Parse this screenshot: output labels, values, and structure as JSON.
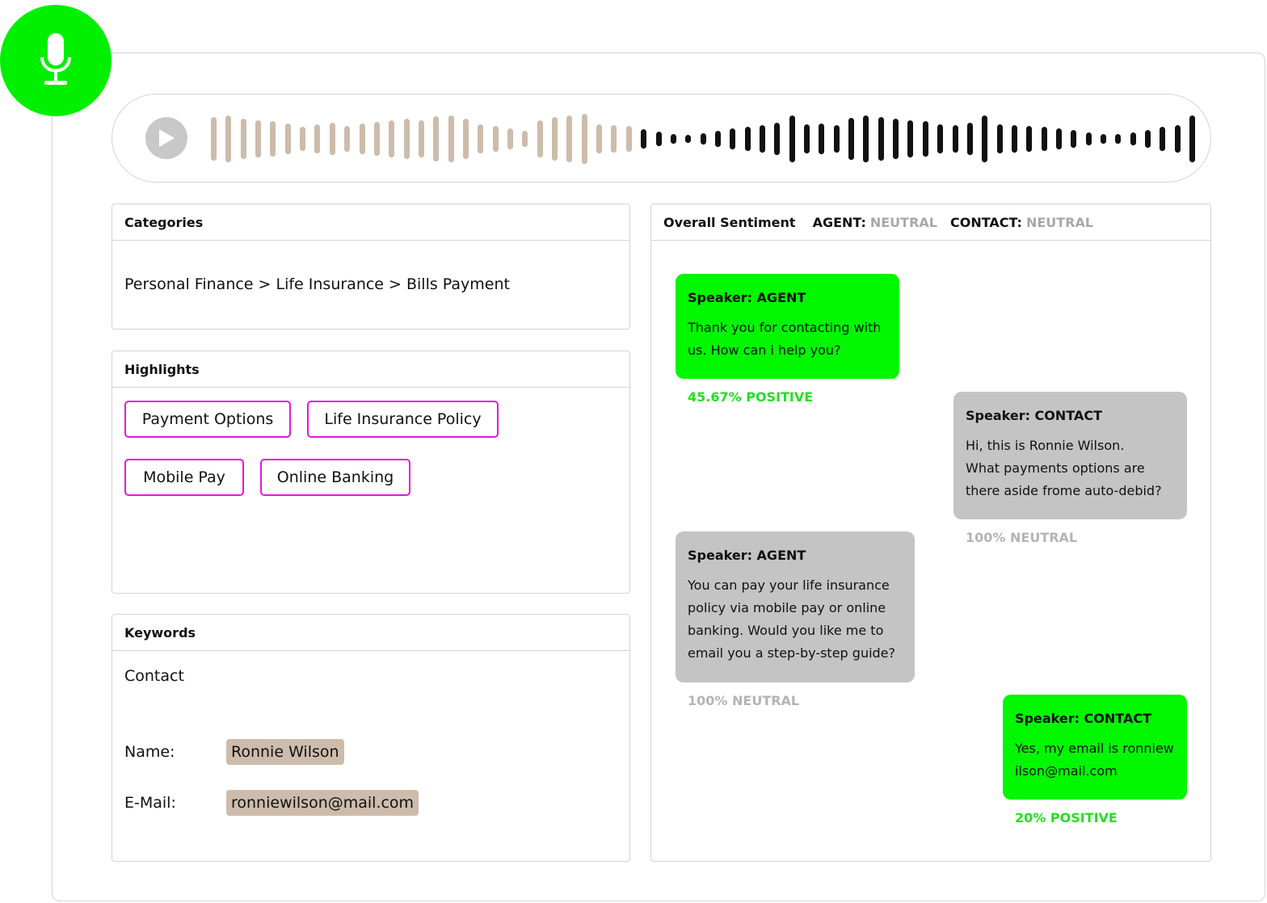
{
  "app": {
    "mic_icon": "microphone-icon",
    "accent": "#00f000"
  },
  "player": {
    "play_icon": "play-icon",
    "played_color": "#cdbcab",
    "remaining_color": "#111111",
    "progress": 0.42
  },
  "categories": {
    "title": "Categories",
    "path": "Personal Finance > Life Insurance > Bills Payment"
  },
  "highlights": {
    "title": "Highlights",
    "chips": [
      "Payment Options",
      "Life Insurance Policy",
      "Mobile Pay",
      "Online Banking"
    ],
    "chip_color": "#e516e0"
  },
  "keywords": {
    "title": "Keywords",
    "section": "Contact",
    "name_label": "Name:",
    "name_value": "Ronnie Wilson",
    "email_label": "E-Mail:",
    "email_value": "ronniewilson@mail.com"
  },
  "sentiment": {
    "title": "Overall Sentiment",
    "agent_label": "AGENT:",
    "agent_value": "NEUTRAL",
    "contact_label": "CONTACT:",
    "contact_value": "NEUTRAL",
    "messages": [
      {
        "speaker": "Speaker: AGENT",
        "text": "Thank you for contacting with us. How can i help you?",
        "score": "45.67% POSITIVE"
      },
      {
        "speaker": "Speaker: CONTACT",
        "text": "Hi, this is Ronnie Wilson.\nWhat payments options are\n there  aside frome auto-debid?",
        "score": "100% NEUTRAL"
      },
      {
        "speaker": "Speaker: AGENT",
        "text": "You can pay your life insurance policy via mobile pay or online banking. Would you like me to email you a step-by-step guide?",
        "score": "100% NEUTRAL"
      },
      {
        "speaker": "Speaker: CONTACT",
        "text": "Yes, my email is ronniewilson@mail.com",
        "score": "20% POSITIVE"
      }
    ],
    "positive_color": "#00f700",
    "neutral_color": "#c4c4c4"
  }
}
